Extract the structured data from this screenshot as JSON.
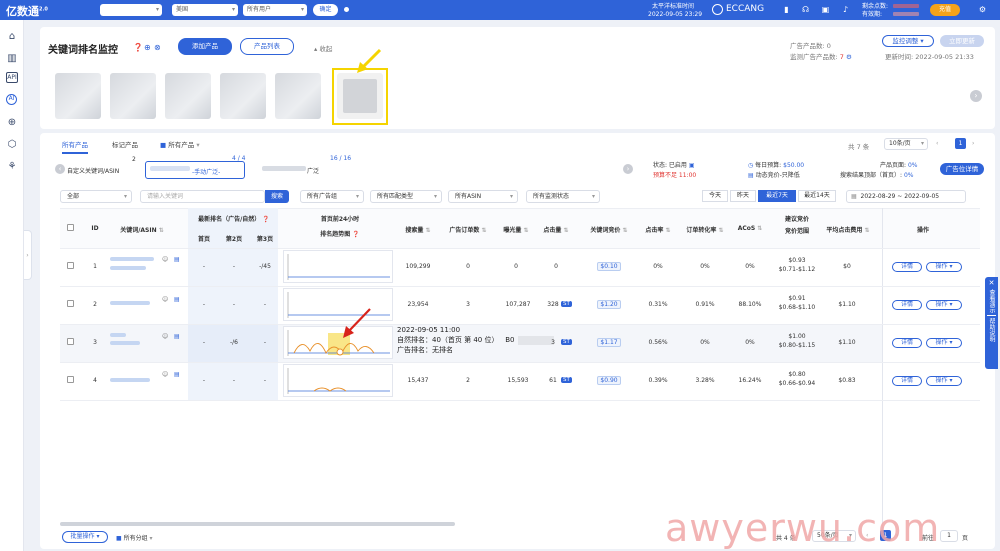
{
  "topbar": {
    "logo": "亿数通",
    "logo_sup": "2.0",
    "region_select": "美国",
    "user_select": "所有用户",
    "confirm_button": "确定",
    "tz_label": "太平洋标准时间",
    "tz_time": "2022-09-05 23:29",
    "brand": "ECCANG",
    "points_label": "剩余点数:",
    "expiry_label": "有效期:",
    "recharge_button": "充值"
  },
  "rail": {
    "icons": [
      "home-icon",
      "chart-icon",
      "api-icon",
      "ai-icon",
      "target-icon",
      "cube-icon",
      "tree-icon"
    ]
  },
  "page": {
    "title": "关键词排名监控",
    "add_product": "添加产品",
    "product_list": "产品列表",
    "collapse": "收起",
    "ad_product_count_label": "广告产品数:",
    "ad_product_count": "0",
    "monitor_ad_count_label": "监测广告产品数:",
    "monitor_ad_count": "7",
    "monitor_adjust": "监控调整",
    "immediate_update": "立即更新",
    "update_time_label": "更新时间:",
    "update_time": "2022-09-05 21:33"
  },
  "tabs": {
    "all_products": "所有产品",
    "tagged_products": "标记产品",
    "all_products_folder": "所有产品",
    "total": "共 7 条",
    "per_page": "10条/页",
    "page": "1"
  },
  "groups": {
    "custom_keyword": "自定义关键词/ASIN",
    "custom_count": "2",
    "manual_label": "-手动广泛-",
    "manual_count": "4 / 4",
    "third_label": "广泛",
    "third_count": "16 / 16",
    "status_label": "状态: 已启用",
    "budget_warning": "预算不足 11:00",
    "daily_budget_label": "每日预算:",
    "daily_budget": "$50.00",
    "bid_strategy": "动态竞价-只降低",
    "product_page_label": "产品页面:",
    "product_page_val": "0%",
    "search_top_label": "搜索结果顶部（首页）:",
    "search_top_val": "0%",
    "ad_position_button": "广告位详情"
  },
  "filters": {
    "all": "全部",
    "keyword_placeholder": "请输入关键词",
    "search_button": "搜索",
    "ad_group": "所有广告组",
    "match_type": "所有匹配类型",
    "asin": "所有ASIN",
    "monitor_status": "所有监测状态",
    "today": "今天",
    "yesterday": "昨天",
    "last7": "最近7天",
    "last14": "最近14天",
    "date_from": "2022-08-29",
    "date_sep": "~",
    "date_to": "2022-09-05"
  },
  "table": {
    "headers": {
      "id": "ID",
      "keyword_asin": "关键词/ASIN",
      "latest_rank": "最新排名（广告/自然）",
      "first_page": "首页",
      "second_page": "第2页",
      "third_page": "第3页",
      "trend_title": "首页前24小时",
      "trend_sub": "排名趋势图",
      "search_volume": "搜索量",
      "ad_orders": "广告订单数",
      "impressions": "曝光量",
      "clicks": "点击量",
      "keyword_bid": "关键词竞价",
      "ctr": "点击率",
      "cvr": "订单转化率",
      "acos": "ACoS",
      "suggested_bid": "建议竞价",
      "bid_range": "竞价范围",
      "avg_cpc": "平均点击费用",
      "actions": "操作"
    },
    "rows": [
      {
        "id": "1",
        "first": "-",
        "second": "-",
        "third": "-/45",
        "search": "109,299",
        "orders": "0",
        "impr": "0",
        "clicks": "0",
        "bid": "$0.10",
        "ctr": "0%",
        "cvr": "0%",
        "acos": "0%",
        "sugg": "$0.93",
        "range": "$0.71-$1.12",
        "cpc": "$0",
        "detail": "详情",
        "op": "操作"
      },
      {
        "id": "2",
        "first": "-",
        "second": "-",
        "third": "-",
        "search": "23,954",
        "orders": "3",
        "impr": "107,287",
        "clicks": "328",
        "bid": "$1.20",
        "ctr": "0.31%",
        "cvr": "0.91%",
        "acos": "88.10%",
        "sugg": "$0.91",
        "range": "$0.68-$1.10",
        "cpc": "$1.10",
        "detail": "详情",
        "op": "操作"
      },
      {
        "id": "3",
        "first": "-",
        "second": "-/6",
        "third": "-",
        "search": "",
        "orders": "",
        "impr": "",
        "clicks": "3",
        "bid": "$1.17",
        "ctr": "0.56%",
        "cvr": "0%",
        "acos": "0%",
        "sugg": "$1.00",
        "range": "$0.80-$1.15",
        "cpc": "$1.10",
        "detail": "详情",
        "op": "操作"
      },
      {
        "id": "4",
        "first": "-",
        "second": "-",
        "third": "-",
        "search": "15,437",
        "orders": "2",
        "impr": "15,593",
        "clicks": "61",
        "bid": "$0.90",
        "ctr": "0.39%",
        "cvr": "3.28%",
        "acos": "16.24%",
        "sugg": "$0.80",
        "range": "$0.66-$0.94",
        "cpc": "$0.83",
        "detail": "详情",
        "op": "操作"
      }
    ],
    "st_badge": "ST",
    "tooltip": {
      "time": "2022-09-05 11:00",
      "natural_rank": "自然排名：40（首页 第 40 位）",
      "asin_prefix": "B0",
      "ad_rank": "广告排名：无排名"
    }
  },
  "footer": {
    "bulk_ops": "批量操作",
    "all_groups": "所有分组",
    "total": "共 4 条",
    "per_page": "50条/页",
    "page": "1",
    "goto_label": "前往",
    "goto_value": "1",
    "goto_suffix": "页"
  },
  "side_float": {
    "demo": "查看演示",
    "help": "帮助说明"
  },
  "watermark": "awyerwu.com",
  "colors": {
    "primary": "#2f63d8",
    "accent": "#f5a31a",
    "warning": "#e0332f",
    "highlight": "#f5d400"
  }
}
